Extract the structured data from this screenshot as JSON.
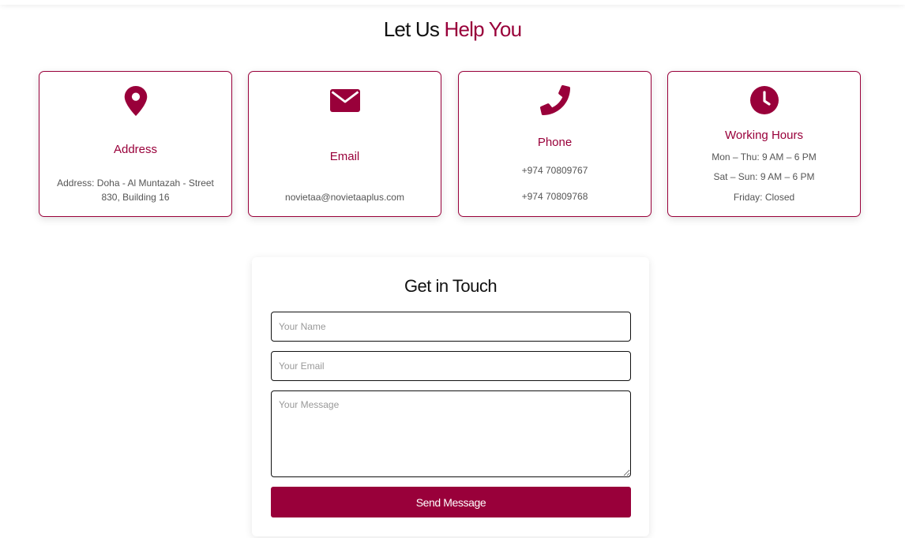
{
  "heading": {
    "main": "Let Us ",
    "accent": "Help You"
  },
  "colors": {
    "accent": "#99003a",
    "text": "#111111",
    "muted": "#555555"
  },
  "cards": [
    {
      "icon": "map-pin-icon",
      "title": "Address",
      "lines": [
        "Address: Doha - Al Muntazah - Street 830, Building 16"
      ]
    },
    {
      "icon": "envelope-icon",
      "title": "Email",
      "lines": [
        "novietaa@novietaaplus.com"
      ]
    },
    {
      "icon": "phone-icon",
      "title": "Phone",
      "lines": [
        "+974 70809767",
        "+974 70809768"
      ]
    },
    {
      "icon": "clock-icon",
      "title": "Working Hours",
      "lines": [
        "Mon – Thu: 9 AM – 6 PM",
        "Sat – Sun: 9 AM – 6 PM",
        "Friday: Closed"
      ]
    }
  ],
  "form": {
    "title": "Get in Touch",
    "name_placeholder": "Your Name",
    "email_placeholder": "Your Email",
    "message_placeholder": "Your Message",
    "submit_label": "Send Message"
  }
}
